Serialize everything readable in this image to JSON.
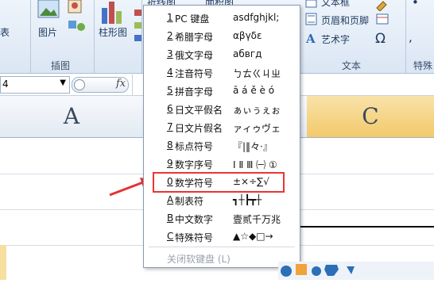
{
  "ribbon": {
    "left_partial": "表",
    "picture": "图片",
    "chart": "柱形图",
    "illustrations_group": "插图",
    "line_chart": "折线图",
    "area_chart": "面积图",
    "textbox": "文本框",
    "header_footer": "页眉和页脚",
    "wordart": "艺术字",
    "text_group": "文本",
    "special_group": "特殊",
    "omega": "Ω"
  },
  "formula_bar": {
    "namebox_value": "4",
    "fx": "fx"
  },
  "columns": [
    "A",
    "C"
  ],
  "menu": {
    "items": [
      {
        "key": "1",
        "name": "PC 键盘",
        "sample": "asdfghjkl;"
      },
      {
        "key": "2",
        "name": "希腊字母",
        "sample": "αβγδε"
      },
      {
        "key": "3",
        "name": "俄文字母",
        "sample": "абвгд"
      },
      {
        "key": "4",
        "name": "注音符号",
        "sample": "ㄅㄊㄍㄐㄓ"
      },
      {
        "key": "5",
        "name": "拼音字母",
        "sample": "ā á ě è ó"
      },
      {
        "key": "6",
        "name": "日文平假名",
        "sample": "ぁぃぅぇぉ"
      },
      {
        "key": "7",
        "name": "日文片假名",
        "sample": "ァィゥヴェ"
      },
      {
        "key": "8",
        "name": "标点符号",
        "sample": "『|‖々·』"
      },
      {
        "key": "9",
        "name": "数字序号",
        "sample": "Ⅰ Ⅱ Ⅲ ㈠ ①"
      },
      {
        "key": "0",
        "name": "数学符号",
        "sample": "±×÷∑√"
      },
      {
        "key": "A",
        "name": "制表符",
        "sample": "┓┼┣┳┼"
      },
      {
        "key": "B",
        "name": "中文数字",
        "sample": "壹贰千万兆"
      },
      {
        "key": "C",
        "name": "特殊符号",
        "sample": "▲☆◆□→"
      }
    ],
    "close": "关闭软键盘 (L)"
  },
  "colors": {
    "highlight": "#e33333",
    "arrow": "#e33333",
    "accent": "#1f5fa8"
  }
}
